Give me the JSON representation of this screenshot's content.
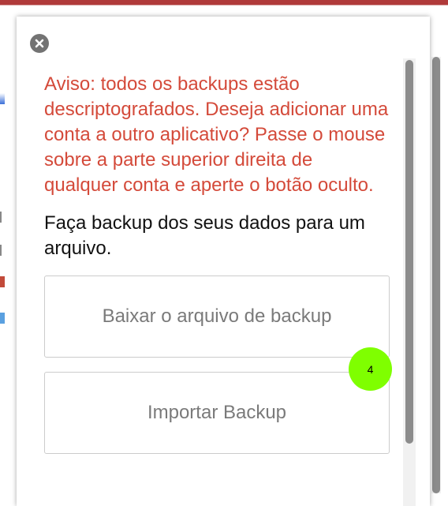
{
  "popup": {
    "close_icon": "close-circle-icon",
    "warning_text": "Aviso: todos os backups estão descriptografados. Deseja adicionar uma conta a outro aplicativo? Passe o mouse sobre a parte superior direita de qualquer conta e aperte o botão oculto.",
    "instruction_text": "Faça backup dos seus dados para um arquivo.",
    "download_button_label": "Baixar o arquivo de backup",
    "import_button_label": "Importar Backup"
  },
  "marker": {
    "label": "4"
  },
  "colors": {
    "warning": "#d44a3a",
    "button_text": "#7a7a7a",
    "marker": "#7fff00",
    "topbar": "#b03a3a"
  }
}
